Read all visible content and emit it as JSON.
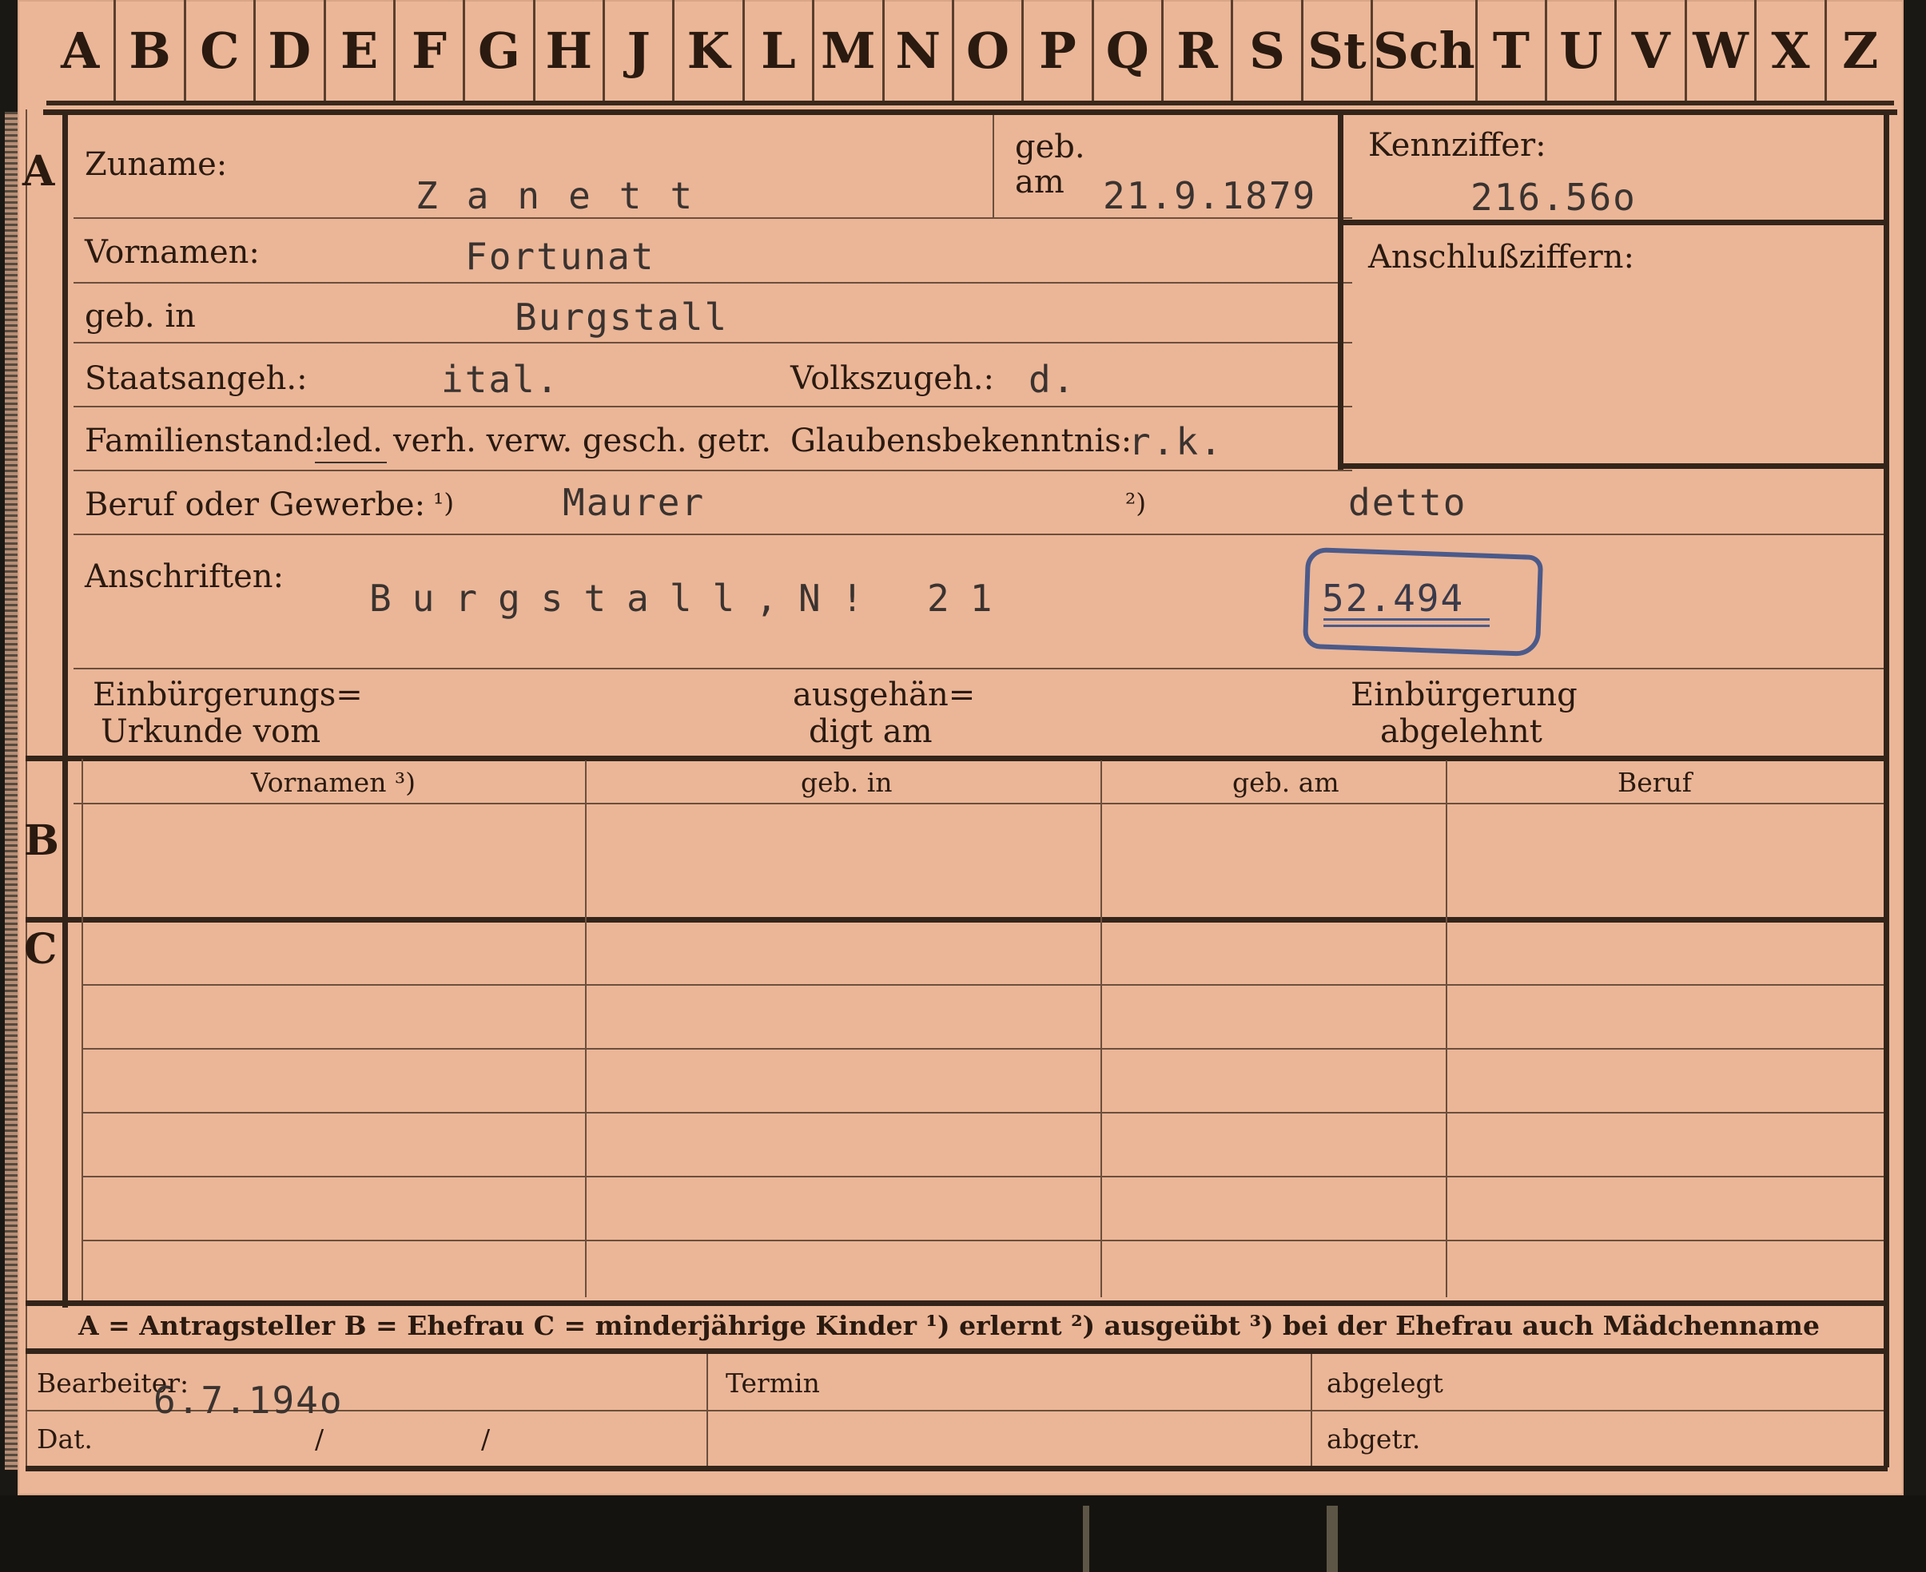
{
  "alphabet": [
    "A",
    "B",
    "C",
    "D",
    "E",
    "F",
    "G",
    "H",
    "J",
    "K",
    "L",
    "M",
    "N",
    "O",
    "P",
    "Q",
    "R",
    "S",
    "St",
    "Sch",
    "T",
    "U",
    "V",
    "W",
    "X",
    "Z"
  ],
  "section_labels": {
    "a": "A",
    "b": "B",
    "c": "C"
  },
  "labels": {
    "zuname": "Zuname:",
    "geb_am_1": "geb.",
    "geb_am_2": "am",
    "kennziffer": "Kennziffer:",
    "vornamen": "Vornamen:",
    "anschlussziffern": "Anschlußziffern:",
    "geb_in": "geb. in",
    "staatsangeh": "Staatsangeh.:",
    "volkszugeh": "Volkszugeh.:",
    "familienstand": "Familienstand:",
    "fam_led": "led.",
    "fam_rest": "verh. verw. gesch. getr.",
    "glaubensbekenntnis": "Glaubensbekenntnis:",
    "beruf": "Beruf oder Gewerbe:",
    "fn1": "¹)",
    "fn2": "²)",
    "anschriften": "Anschriften:",
    "einbuergerung_1": "Einbürgerungs=",
    "einbuergerung_2": "Urkunde vom",
    "ausgehaendigt_1": "ausgehän=",
    "ausgehaendigt_2": "digt am",
    "abgelehnt_1": "Einbürgerung",
    "abgelehnt_2": "abgelehnt",
    "col_vornamen": "Vornamen ³)",
    "col_geb_in": "geb. in",
    "col_geb_am": "geb. am",
    "col_beruf": "Beruf",
    "legend": "A = Antragsteller   B = Ehefrau   C = minderjährige Kinder   ¹) erlernt   ²) ausgeübt   ³) bei der Ehefrau auch Mädchenname",
    "bearbeiter": "Bearbeiter:",
    "dat": "Dat.",
    "slash1": "/",
    "slash2": "/",
    "termin": "Termin",
    "abgelegt": "abgelegt",
    "abgetr": "abgetr."
  },
  "values": {
    "zuname": "Zanett",
    "geb_am": "21.9.1879",
    "kennziffer": "216.56o",
    "vornamen": "Fortunat",
    "geb_in": "Burgstall",
    "staatsangeh": "ital.",
    "volkszugeh": "d.",
    "glaubensbekenntnis": "r.k.",
    "beruf_erlernt": "Maurer",
    "beruf_ausgeuebt": "detto",
    "anschrift": "Burgstall,N! 21",
    "stamp_number": "52.494",
    "bearbeiter_date": "6.7.194o"
  },
  "colors": {
    "card": "#ebb697",
    "ink": "#2a1a10",
    "stamp": "#4b5a8a"
  }
}
